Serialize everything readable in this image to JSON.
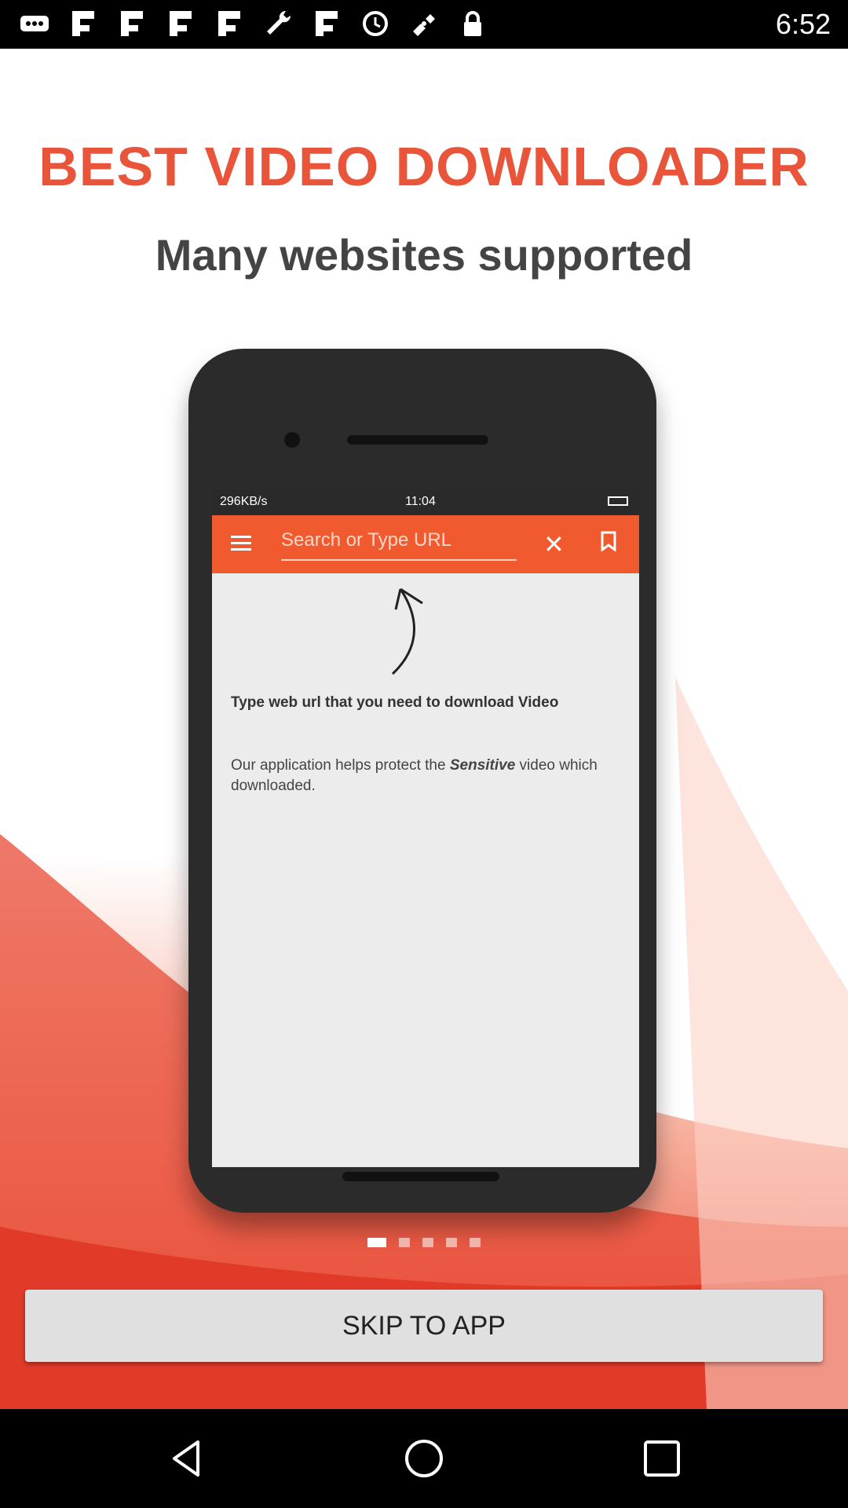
{
  "status_bar": {
    "time": "6:52",
    "icons": [
      "more-icon",
      "flipboard-icon",
      "flipboard-icon",
      "flipboard-icon",
      "flipboard-icon",
      "wrench-icon",
      "flipboard-icon",
      "alarm-icon",
      "fake-gps-icon",
      "lock-icon"
    ]
  },
  "onboarding": {
    "headline": "BEST VIDEO DOWNLOADER",
    "subhead": "Many websites supported",
    "colors": {
      "headline": "#e8553a",
      "accent": "#f05a2e"
    }
  },
  "phone_screen": {
    "status_left": "296KB/s",
    "status_time": "11:04",
    "search_placeholder": "Search or Type URL",
    "message_title": "Type web url that you need to download Video",
    "message_body_prefix": "Our application helps protect the ",
    "message_body_emphasis": "Sensitive",
    "message_body_suffix": " video which downloaded."
  },
  "pager": {
    "total": 5,
    "active_index": 0
  },
  "skip_button": {
    "label": "skip to app"
  },
  "nav_bar": {
    "back": "back-icon",
    "home": "home-icon",
    "recents": "recents-icon"
  }
}
